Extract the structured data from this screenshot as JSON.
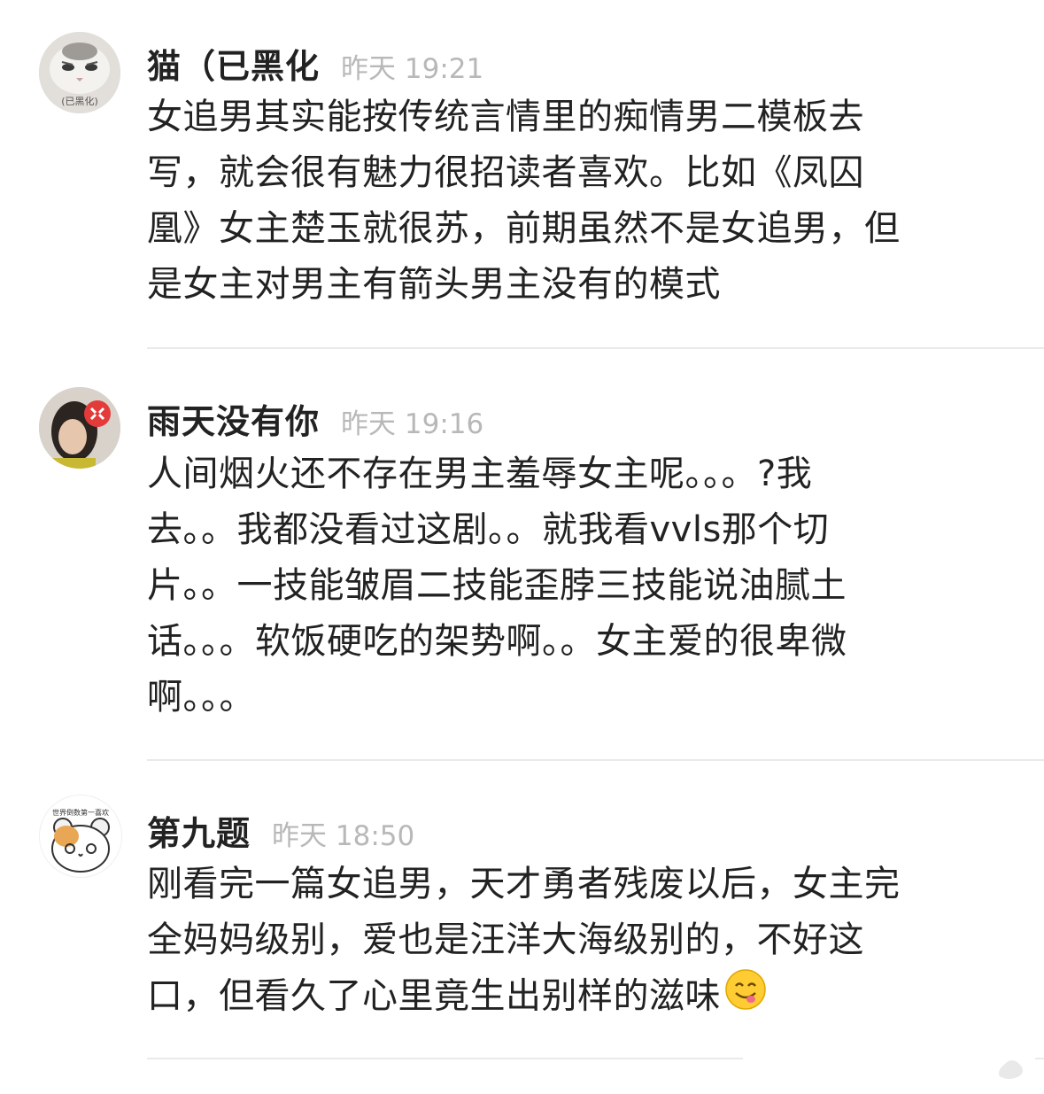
{
  "comments": [
    {
      "name": "猫（已黑化",
      "time": "昨天 19:21",
      "text": "女追男其实能按传统言情里的痴情男二模板去\n写，就会很有魅力很招读者喜欢。比如《凤囚\n凰》女主楚玉就很苏，前期虽然不是女追男，但\n是女主对男主有箭头男主没有的模式",
      "avatar_caption": "(已黑化)"
    },
    {
      "name": "雨天没有你",
      "time": "昨天 19:16",
      "text": "人间烟火还不存在男主羞辱女主呢。。。?我\n去。。我都没看过这剧。。就我看vvls那个切\n片。。一技能皱眉二技能歪脖三技能说油腻土\n话。。。软饭硬吃的架势啊。。女主爱的很卑微\n啊。。。"
    },
    {
      "name": "第九题",
      "time": "昨天 18:50",
      "text": "刚看完一篇女追男，天才勇者残废以后，女主完\n全妈妈级别，爱也是汪洋大海级别的，不好这\n口，但看久了心里竟生出别样的滋味",
      "avatar_caption": "世界倒数第一喜欢"
    }
  ],
  "icons": {
    "emoji": "yum-face-emoji",
    "watermark": "weibo-logo-icon"
  },
  "colors": {
    "time": "#b8b8b8",
    "divider": "#eaeaea"
  }
}
